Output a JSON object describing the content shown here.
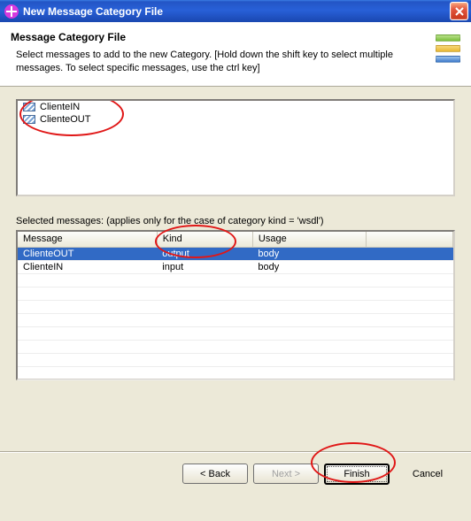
{
  "titlebar": {
    "title": "New Message Category File"
  },
  "header": {
    "title": "Message Category File",
    "description": "Select messages to add to the new Category. [Hold down the shift key to select multiple messages. To select specific messages, use the ctrl key]"
  },
  "messages": {
    "items": [
      {
        "label": "ClienteIN"
      },
      {
        "label": "ClienteOUT"
      }
    ]
  },
  "selected": {
    "label": "Selected messages: (applies only for the case of category kind = 'wsdl')",
    "columns": {
      "c0": "Message",
      "c1": "Kind",
      "c2": "Usage"
    },
    "rows": [
      {
        "message": "ClienteOUT",
        "kind": "output",
        "usage": "body",
        "selected": true
      },
      {
        "message": "ClienteIN",
        "kind": "input",
        "usage": "body",
        "selected": false
      }
    ]
  },
  "buttons": {
    "back": "< Back",
    "next": "Next >",
    "finish": "Finish",
    "cancel": "Cancel"
  }
}
